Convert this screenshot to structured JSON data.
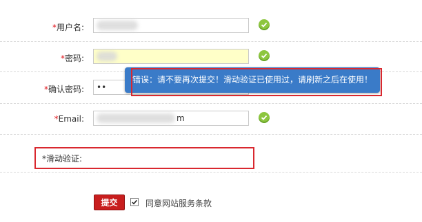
{
  "form": {
    "username": {
      "required_mark": "*",
      "label": "用户名:",
      "value": ""
    },
    "password": {
      "required_mark": "*",
      "label": "密码:",
      "value": ""
    },
    "confirm_password": {
      "required_mark": "*",
      "label": "确认密码:",
      "value": "••"
    },
    "email": {
      "required_mark": "*",
      "label": "Email:",
      "value_start": "",
      "value_end": "m"
    },
    "slider_captcha": {
      "required_mark": "*",
      "label": "滑动验证:"
    },
    "valid_icon": "check-circle-icon"
  },
  "error_tooltip": {
    "text": "错误：请不要再次提交！滑动验证已使用过，请刷新之后在使用！",
    "background": "#3a7bc8"
  },
  "actions": {
    "submit_label": "提交",
    "agree_label": "同意网站服务条款",
    "agree_checked": true
  },
  "colors": {
    "required": "#e0141b",
    "submit_bg": "#c81e1e",
    "highlight_box": "#d9282f",
    "valid": "#8dc63f",
    "password_field_bg": "#ffffc8"
  }
}
